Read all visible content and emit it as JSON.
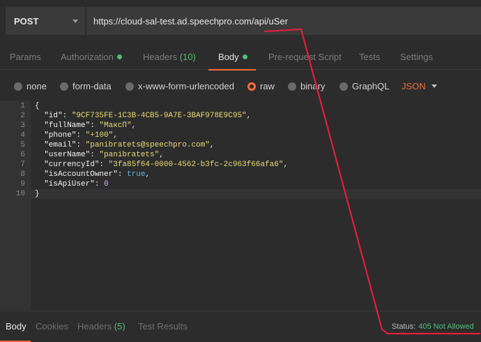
{
  "request": {
    "method": "POST",
    "url": "https://cloud-sal-test.ad.speechpro.com/api/uSer"
  },
  "tabs": {
    "params": "Params",
    "authorization": "Authorization",
    "headers": "Headers",
    "headers_count": "(10)",
    "body": "Body",
    "prerequest": "Pre-request Script",
    "tests": "Tests",
    "settings": "Settings",
    "active": "Body"
  },
  "body_modes": {
    "none": "none",
    "form_data": "form-data",
    "urlencoded": "x-www-form-urlencoded",
    "raw": "raw",
    "binary": "binary",
    "graphql": "GraphQL",
    "selected": "raw",
    "format": "JSON"
  },
  "editor": {
    "line_numbers": [
      "1",
      "2",
      "3",
      "4",
      "5",
      "6",
      "7",
      "8",
      "9",
      "10"
    ],
    "lines": [
      "{",
      "  \"id\": \"9CF735FE-1C3B-4CB5-9A7E-3BAF978E9C95\",",
      "  \"fullName\": \"МаксП\",",
      "  \"phone\": \"+100\",",
      "  \"email\": \"panibratets@speechpro.com\",",
      "  \"userName\": \"panibratets\",",
      "  \"currencyId\": \"3fa85f64-0000-4562-b3fc-2c963f66afa6\",",
      "  \"isAccountOwner\": true,",
      "  \"isApiUser\": 0",
      "}"
    ]
  },
  "response": {
    "body": "Body",
    "cookies": "Cookies",
    "headers": "Headers",
    "headers_count": "(5)",
    "test_results": "Test Results",
    "status_label": "Status:",
    "status_value": "405 Not Allowed"
  },
  "colors": {
    "accent": "#f26b3a",
    "success": "#4fbf77",
    "annotation": "#e0203a",
    "background": "#2c2c2c"
  }
}
